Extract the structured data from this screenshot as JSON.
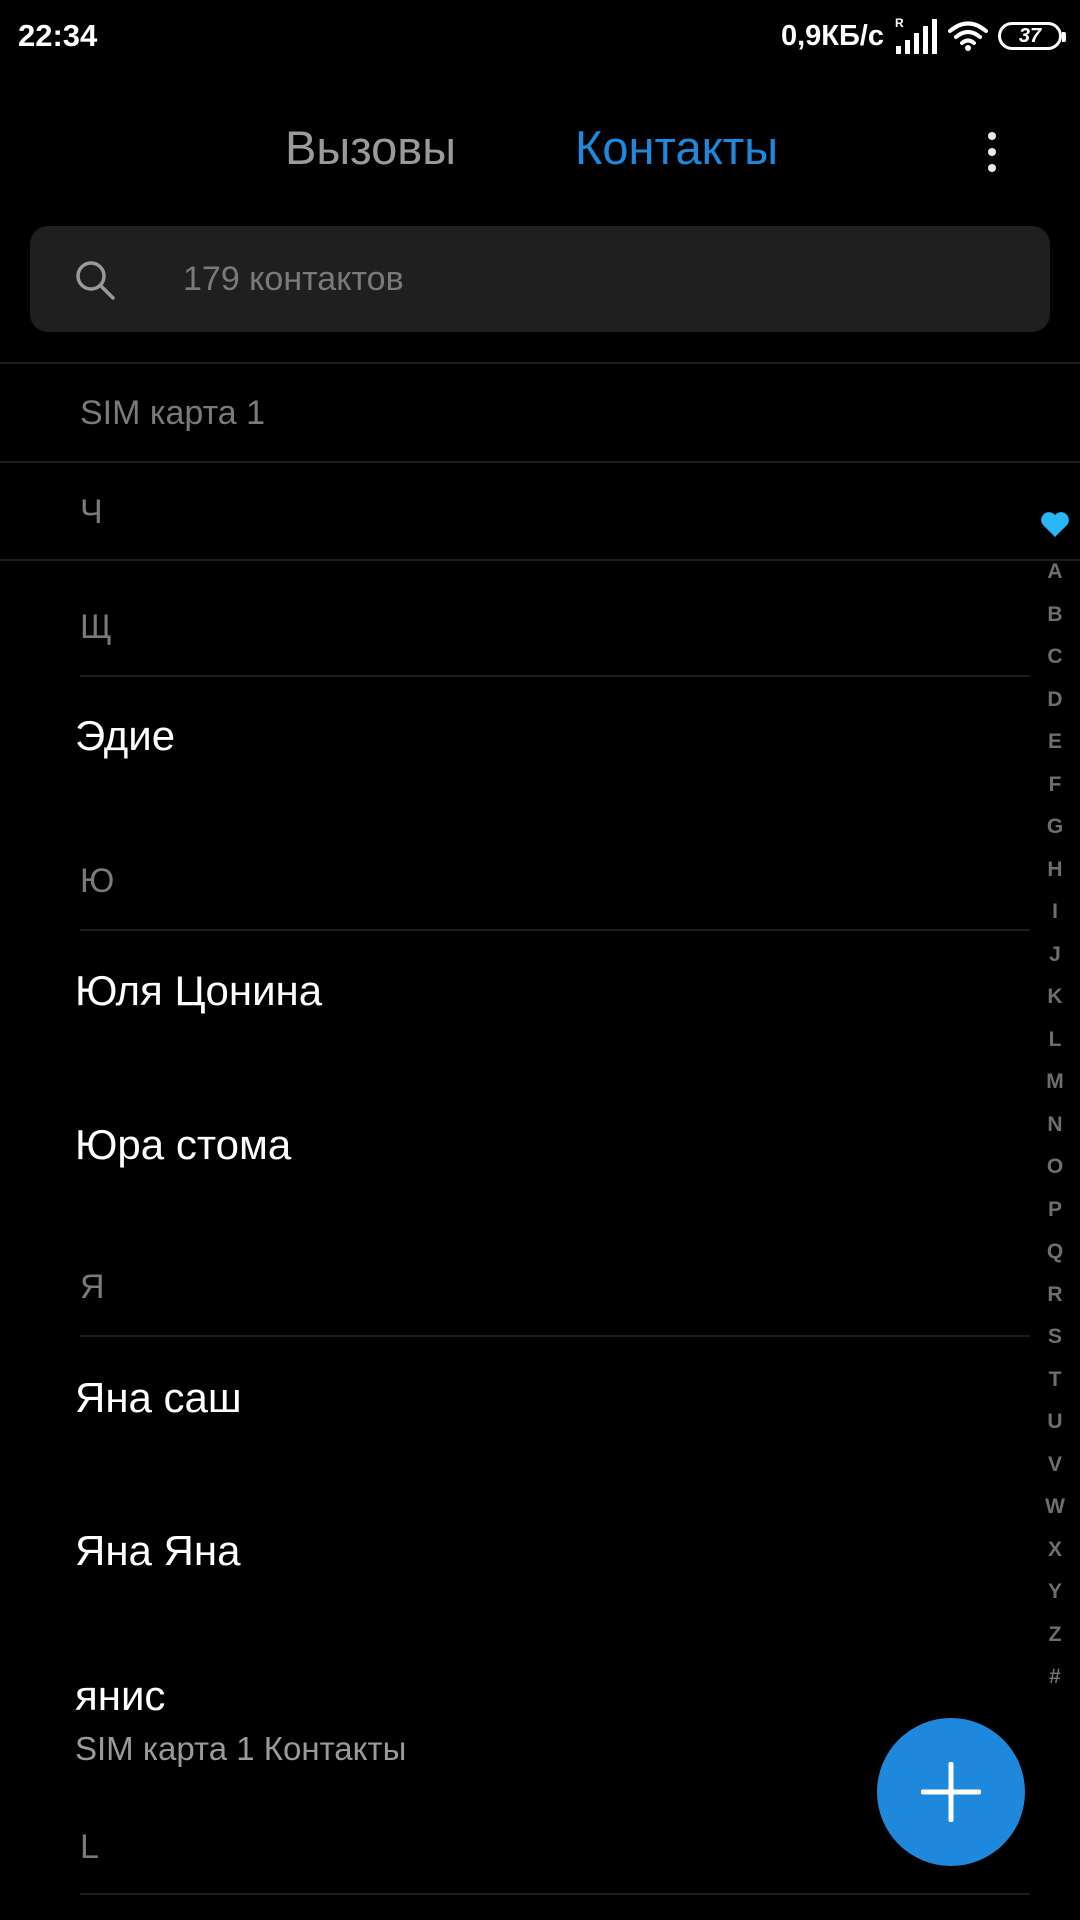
{
  "status_bar": {
    "time": "22:34",
    "net_speed": "0,9КБ/с",
    "battery": "37"
  },
  "tabs": {
    "calls": "Вызовы",
    "contacts": "Контакты",
    "active": "contacts"
  },
  "search": {
    "placeholder": "179 контактов"
  },
  "sticky_headers": {
    "sim": "SIM карта 1",
    "ch": "Ч"
  },
  "list": {
    "letters": {
      "shch": "Щ",
      "yu": "Ю",
      "ya": "Я",
      "l": "L"
    },
    "contacts": [
      {
        "name": "Эдие"
      },
      {
        "name": "Юля Цонина"
      },
      {
        "name": "Юра стома"
      },
      {
        "name": "Яна саш"
      },
      {
        "name": "Яна Яна"
      },
      {
        "name": "янис",
        "sub": "SIM карта 1 Контакты"
      }
    ]
  },
  "alpha_index": [
    "A",
    "B",
    "C",
    "D",
    "E",
    "F",
    "G",
    "H",
    "I",
    "J",
    "K",
    "L",
    "M",
    "N",
    "O",
    "P",
    "Q",
    "R",
    "S",
    "T",
    "U",
    "V",
    "W",
    "X",
    "Y",
    "Z",
    "#"
  ],
  "colors": {
    "accent": "#1e88dc",
    "favorite": "#29b6f6",
    "background": "#000000"
  },
  "icons": {
    "search": "search-icon",
    "more": "more-vertical-icon",
    "favorite": "heart-icon",
    "add": "plus-icon"
  }
}
